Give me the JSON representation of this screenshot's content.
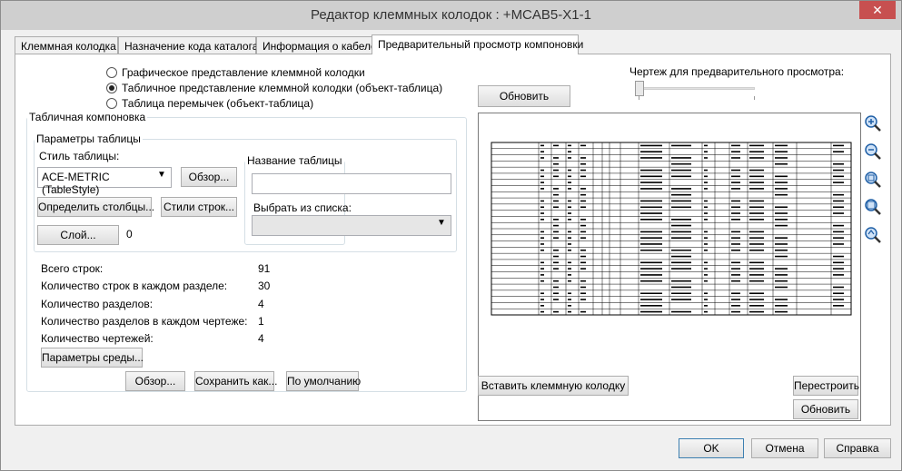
{
  "window": {
    "title": "Редактор клеммных колодок : +MCAB5-X1-1",
    "close_glyph": "✕"
  },
  "tabs": [
    {
      "label": "Клеммная колодка"
    },
    {
      "label": "Назначение кода каталога"
    },
    {
      "label": "Информация о кабеле"
    },
    {
      "label": "Предварительный просмотр компоновки",
      "active": true
    }
  ],
  "layout_options": [
    {
      "label": "Графическое представление клеммной колодки",
      "selected": false
    },
    {
      "label": "Табличное представление клеммной колодки (объект-таблица)",
      "selected": true
    },
    {
      "label": "Таблица перемычек (объект-таблица)",
      "selected": false
    }
  ],
  "table_layout": {
    "legend": "Табличная компоновка",
    "params_legend": "Параметры таблицы",
    "style_label": "Стиль таблицы:",
    "style_value": "ACE-METRIC (TableStyle)",
    "browse_button": "Обзор...",
    "define_columns_button": "Определить столбцы...",
    "cell_styles_button": "Стили строк...",
    "layer_button": "Слой...",
    "layer_value": "0",
    "name_legend": "Название таблицы",
    "name_value": "",
    "pick_legend": "Выбрать из списка:",
    "pick_value": ""
  },
  "stats": [
    {
      "label": "Всего строк:",
      "value": "91"
    },
    {
      "label": "Количество строк в каждом разделе:",
      "value": "30"
    },
    {
      "label": "Количество разделов:",
      "value": "4"
    },
    {
      "label": "Количество разделов в каждом чертеже:",
      "value": "1"
    },
    {
      "label": "Количество чертежей:",
      "value": "4"
    }
  ],
  "env_button": "Параметры среды...",
  "bottom_buttons": {
    "browse": "Обзор...",
    "save_as": "Сохранить как...",
    "default": "По умолчанию"
  },
  "preview": {
    "drawing_label": "Чертеж для предварительного просмотра:",
    "refresh_button": "Обновить",
    "slider_level": 0,
    "insert_button": "Вставить клеммную колодку",
    "rebuild_button": "Перестроить",
    "update_button": "Обновить",
    "zoom_icons": [
      "zoom-in-icon",
      "zoom-out-icon",
      "zoom-window-icon",
      "zoom-extents-icon",
      "zoom-previous-icon"
    ]
  },
  "dialog_buttons": {
    "ok": "OK",
    "cancel": "Отмена",
    "help": "Справка"
  },
  "colors": {
    "title_bg": "#cfcfcf",
    "close_bg": "#c75050",
    "zoom_blue": "#1f5fa6"
  }
}
